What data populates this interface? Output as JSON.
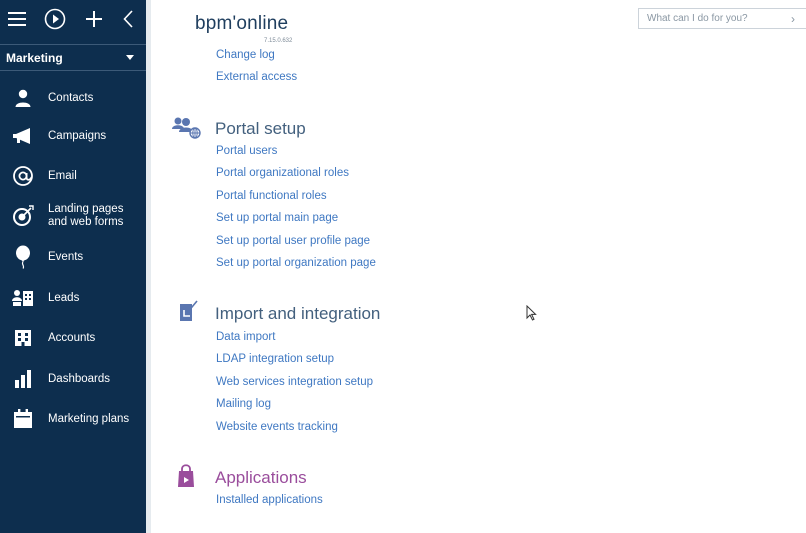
{
  "topbar": {
    "icons": [
      "menu-icon",
      "play-icon",
      "plus-icon",
      "chevron-left-icon"
    ]
  },
  "workspace": {
    "label": "Marketing"
  },
  "nav": [
    {
      "label": "Contacts",
      "icon": "contact-person-icon"
    },
    {
      "label": "Campaigns",
      "icon": "megaphone-icon"
    },
    {
      "label": "Email",
      "icon": "at-sign-icon"
    },
    {
      "label": "Landing pages\nand web forms",
      "icon": "target-icon"
    },
    {
      "label": "Events",
      "icon": "balloon-icon"
    },
    {
      "label": "Leads",
      "icon": "leads-icon"
    },
    {
      "label": "Accounts",
      "icon": "building-icon"
    },
    {
      "label": "Dashboards",
      "icon": "bar-chart-icon"
    },
    {
      "label": "Marketing plans",
      "icon": "calendar-icon"
    }
  ],
  "header": {
    "logo": "bpm'online",
    "version": "7.15.0.632",
    "search_placeholder": "What can I do for you?"
  },
  "sections": {
    "top_links": [
      "Change log",
      "External access"
    ],
    "portal": {
      "title": "Portal setup",
      "links": [
        "Portal users",
        "Portal organizational roles",
        "Portal functional roles",
        "Set up portal main page",
        "Set up portal user profile page",
        "Set up portal organization page"
      ]
    },
    "import": {
      "title": "Import and integration",
      "links": [
        "Data import",
        "LDAP integration setup",
        "Web services integration setup",
        "Mailing log",
        "Website events tracking"
      ]
    },
    "apps": {
      "title": "Applications",
      "links": [
        "Installed applications"
      ]
    }
  },
  "colors": {
    "sidebar": "#0d2e4e",
    "link": "#3f78c2",
    "section_title": "#43607e",
    "apps_title": "#9a4d9c",
    "section_icon": "#5a76b0"
  }
}
